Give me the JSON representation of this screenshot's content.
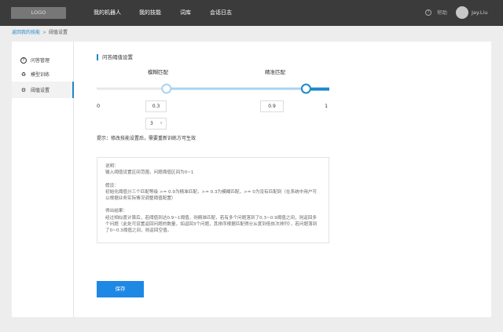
{
  "header": {
    "logo": "LOGO",
    "nav": [
      "我的机器人",
      "我的技能",
      "词库",
      "会话日志"
    ],
    "help": "帮助",
    "username": "Jay.Liu"
  },
  "breadcrumb": {
    "back": "返回我的技能",
    "sep": ">",
    "current": "阈值设置"
  },
  "sidebar": {
    "items": [
      {
        "label": "问答管理",
        "icon": "question-circle-icon"
      },
      {
        "label": "模型训练",
        "icon": "recycle-icon"
      },
      {
        "label": "阈值设置",
        "icon": "gear-icon"
      }
    ]
  },
  "main": {
    "section_title": "问答阈值设置",
    "fuzzy_label": "模糊匹配",
    "exact_label": "精准匹配",
    "min_label": "0",
    "max_label": "1",
    "fuzzy_value": "0.3",
    "exact_value": "0.9",
    "fuzzy_threshold": 0.3,
    "exact_threshold": 0.9,
    "count_value": "3",
    "tip": "提示：修改技能设置后，需要重新训练方可生效",
    "desc": {
      "title1": "说明：",
      "line1": "输入阈值设置区间范围，问题阈值区间为0~1",
      "title2": "假设：",
      "line2": "初始化阈值分三个匹配等级 >= 0.9为精准匹配，>= 0.3为模糊匹配，>= 0为没有匹配到（在系统中用户可以根据业务实际情况调整阈值配置）",
      "title3": "得出结果：",
      "line3": "经过相似度计算后，若阈值到达0.9~1阈值，则精准匹配，若有多个问题落到了0.3~0.9阈值之间，则返回多个问题（此处可设置返回问题的数量，如返回3个问题，其排序根据匹配得分从度到低依次排列），若问题落到了0~0.3阈值之间，则返回空值。"
    },
    "save_label": "保存"
  },
  "colors": {
    "accent": "#1e88c9",
    "track_light": "#a9d4f2",
    "topbar": "#3b3b3b"
  }
}
